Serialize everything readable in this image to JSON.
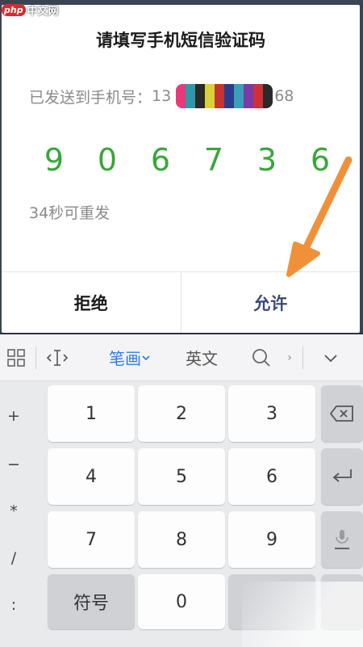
{
  "watermark": {
    "logo": "php",
    "text": "中文网"
  },
  "dialog": {
    "title": "请填写手机短信验证码",
    "sent_label": "已发送到手机号：",
    "phone_visible_start": "13",
    "phone_visible_end": "68",
    "phone_mask_colors": [
      "#e83a7a",
      "#2f98a8",
      "#2a2a2a",
      "#d8d23a",
      "#c4352d",
      "#2c3c8c",
      "#3aa0b8",
      "#7a3aa8",
      "#d02f3a",
      "#2a2a2a"
    ],
    "code_digits": [
      "9",
      "0",
      "6",
      "7",
      "3",
      "6"
    ],
    "resend": "34秒可重发",
    "deny_label": "拒绝",
    "allow_label": "允许",
    "code_color": "#3aa53a",
    "arrow_color": "#f0913a"
  },
  "keyboard": {
    "toolbar": {
      "grid_icon": "grid-icon",
      "cursor_icon": "cursor-icon",
      "stroke_label": "笔画",
      "english_label": "英文",
      "search_icon": "search-icon",
      "more_icon": "chevron-right-icon",
      "collapse_icon": "chevron-down-icon"
    },
    "side_keys": [
      "+",
      "−",
      "*",
      "/",
      ":"
    ],
    "digits": [
      "1",
      "2",
      "3",
      "4",
      "5",
      "6",
      "7",
      "8",
      "9"
    ],
    "symbols_label": "符号",
    "zero_label": "0"
  }
}
